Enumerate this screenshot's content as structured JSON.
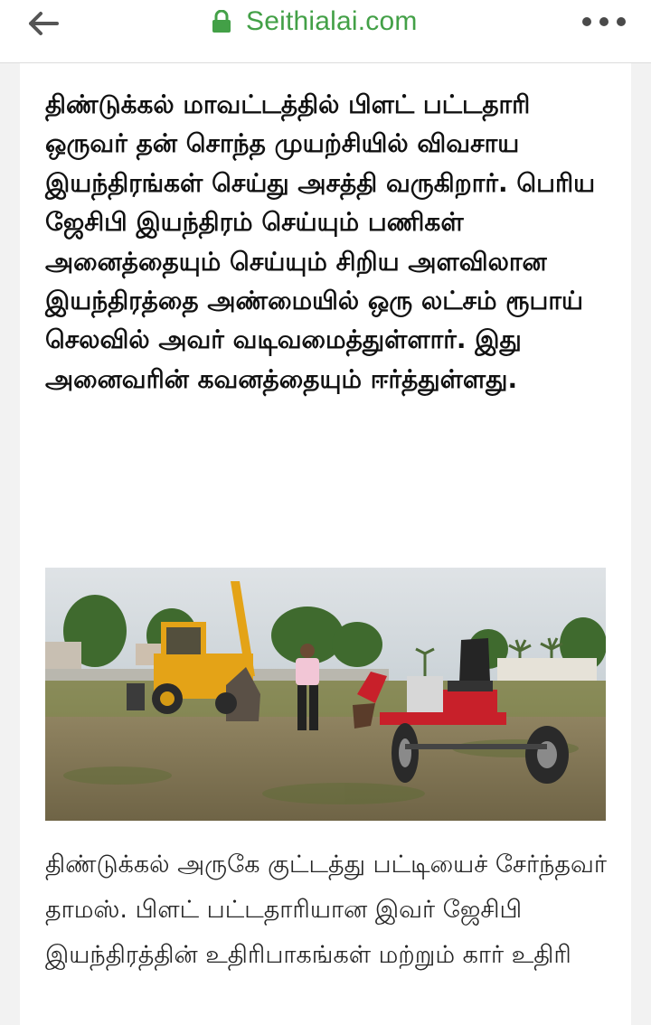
{
  "browser": {
    "url": "Seithialai.com",
    "back_icon": "arrow-left-icon",
    "lock_icon": "lock-icon",
    "menu_icon": "more-horizontal-icon",
    "url_color": "#43a047"
  },
  "article": {
    "headline": "திண்டுக்கல் மாவட்டத்தில் பிளட் பட்டதாரி ஒருவர் தன் சொந்த முயற்சியில் விவசாய இயந்திரங்கள் செய்து அசத்தி வருகிறார். பெரிய ஜேசிபி இயந்திரம் செய்யும் பணிகள் அனைத்தையும் செய்யும் சிறிய அளவிலான இயந்திரத்தை அண்மையில் ஒரு லட்சம் ரூபாய் செலவில் அவர் வடிவமைத்துள்ளார். இது அனைவரின் கவனத்தையும் ஈர்த்துள்ளது.",
    "caption": "திண்டுக்கல் அருகே குட்டத்து பட்டியைச் சேர்ந்தவர் தாமஸ். பிளட் பட்டதாரியான இவர் ஜேசிபி இயந்திரத்தின் உதிரிபாகங்கள் மற்றும் கார் உதிரி"
  }
}
